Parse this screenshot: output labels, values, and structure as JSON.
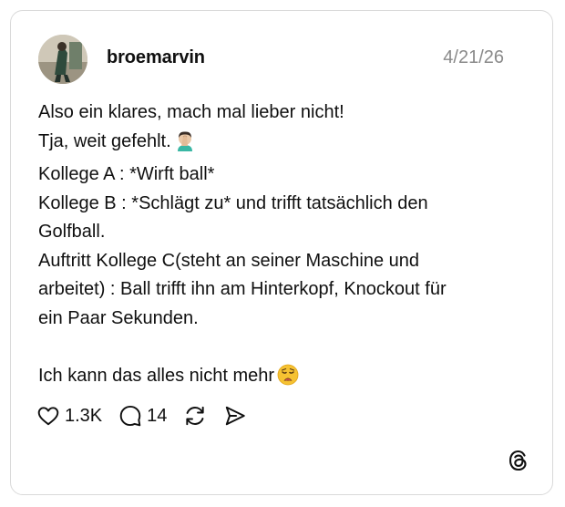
{
  "post": {
    "username": "broemarvin",
    "date": "4/21/26",
    "lines": [
      "Also ein klares, mach mal lieber nicht!",
      "Tja, weit gefehlt.",
      "Kollege A : *Wirft ball*",
      "Kollege B : *Schlägt zu* und trifft tatsächlich den",
      "Golfball.",
      "Auftritt Kollege C(steht an seiner Maschine und",
      "arbeitet) : Ball trifft ihn am Hinterkopf, Knockout für",
      "ein Paar Sekunden.",
      "Ich kann das alles nicht mehr"
    ],
    "emojis": {
      "line2": "man-facepalming-emoji",
      "line9": "weary-face-emoji"
    }
  },
  "actions": {
    "likes": "1.3K",
    "replies": "14",
    "icons": [
      "heart-icon",
      "comment-icon",
      "repost-icon",
      "share-icon"
    ]
  },
  "brand": {
    "logo": "threads-logo-icon",
    "text_color": "#101010",
    "muted_color": "#8a8a8a",
    "border_color": "#d9d9d9"
  }
}
